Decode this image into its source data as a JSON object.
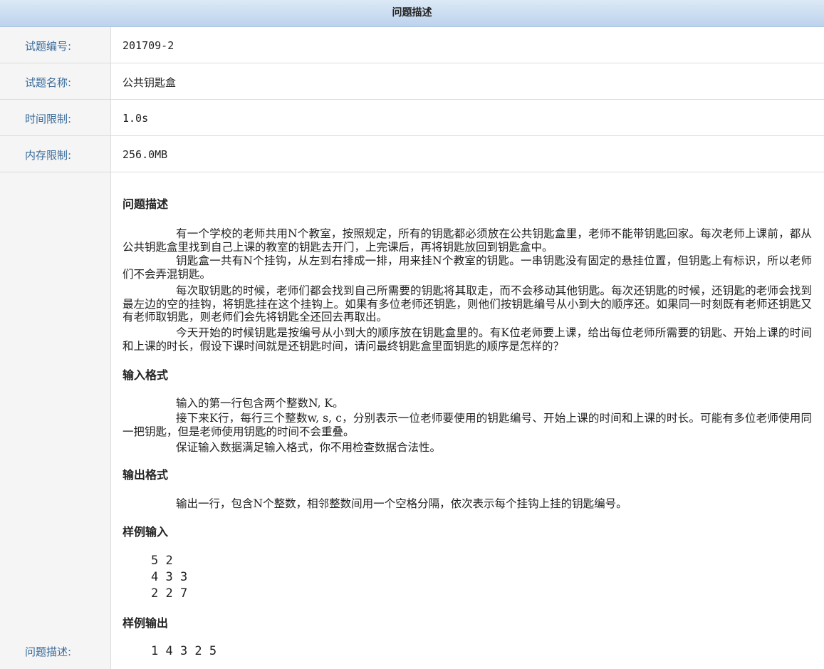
{
  "header": {
    "title": "问题描述"
  },
  "info": [
    {
      "label": "试题编号:",
      "value": "201709-2"
    },
    {
      "label": "试题名称:",
      "value": "公共钥匙盒"
    },
    {
      "label": "时间限制:",
      "value": "1.0s"
    },
    {
      "label": "内存限制:",
      "value": "256.0MB"
    }
  ],
  "problem": {
    "label": "问题描述:",
    "sections": {
      "description": {
        "title": "问题描述",
        "paragraphs": [
          "有一个学校的老师共用N个教室，按照规定，所有的钥匙都必须放在公共钥匙盒里，老师不能带钥匙回家。每次老师上课前，都从公共钥匙盒里找到自己上课的教室的钥匙去开门，上完课后，再将钥匙放回到钥匙盒中。",
          "钥匙盒一共有N个挂钩，从左到右排成一排，用来挂N个教室的钥匙。一串钥匙没有固定的悬挂位置，但钥匙上有标识，所以老师们不会弄混钥匙。",
          "每次取钥匙的时候，老师们都会找到自己所需要的钥匙将其取走，而不会移动其他钥匙。每次还钥匙的时候，还钥匙的老师会找到最左边的空的挂钩，将钥匙挂在这个挂钩上。如果有多位老师还钥匙，则他们按钥匙编号从小到大的顺序还。如果同一时刻既有老师还钥匙又有老师取钥匙，则老师们会先将钥匙全还回去再取出。",
          "今天开始的时候钥匙是按编号从小到大的顺序放在钥匙盒里的。有K位老师要上课，给出每位老师所需要的钥匙、开始上课的时间和上课的时长，假设下课时间就是还钥匙时间，请问最终钥匙盒里面钥匙的顺序是怎样的？"
        ]
      },
      "input": {
        "title": "输入格式",
        "paragraphs": [
          "输入的第一行包含两个整数N, K。",
          "接下来K行，每行三个整数w, s, c，分别表示一位老师要使用的钥匙编号、开始上课的时间和上课的时长。可能有多位老师使用同一把钥匙，但是老师使用钥匙的时间不会重叠。",
          "保证输入数据满足输入格式，你不用检查数据合法性。"
        ]
      },
      "output": {
        "title": "输出格式",
        "paragraphs": [
          "输出一行，包含N个整数，相邻整数间用一个空格分隔，依次表示每个挂钩上挂的钥匙编号。"
        ]
      },
      "sample_input": {
        "title": "样例输入",
        "lines": [
          "5 2",
          "4 3 3",
          "2 2 7"
        ]
      },
      "sample_output": {
        "title": "样例输出",
        "lines": [
          "1 4 3 2 5"
        ]
      }
    }
  }
}
